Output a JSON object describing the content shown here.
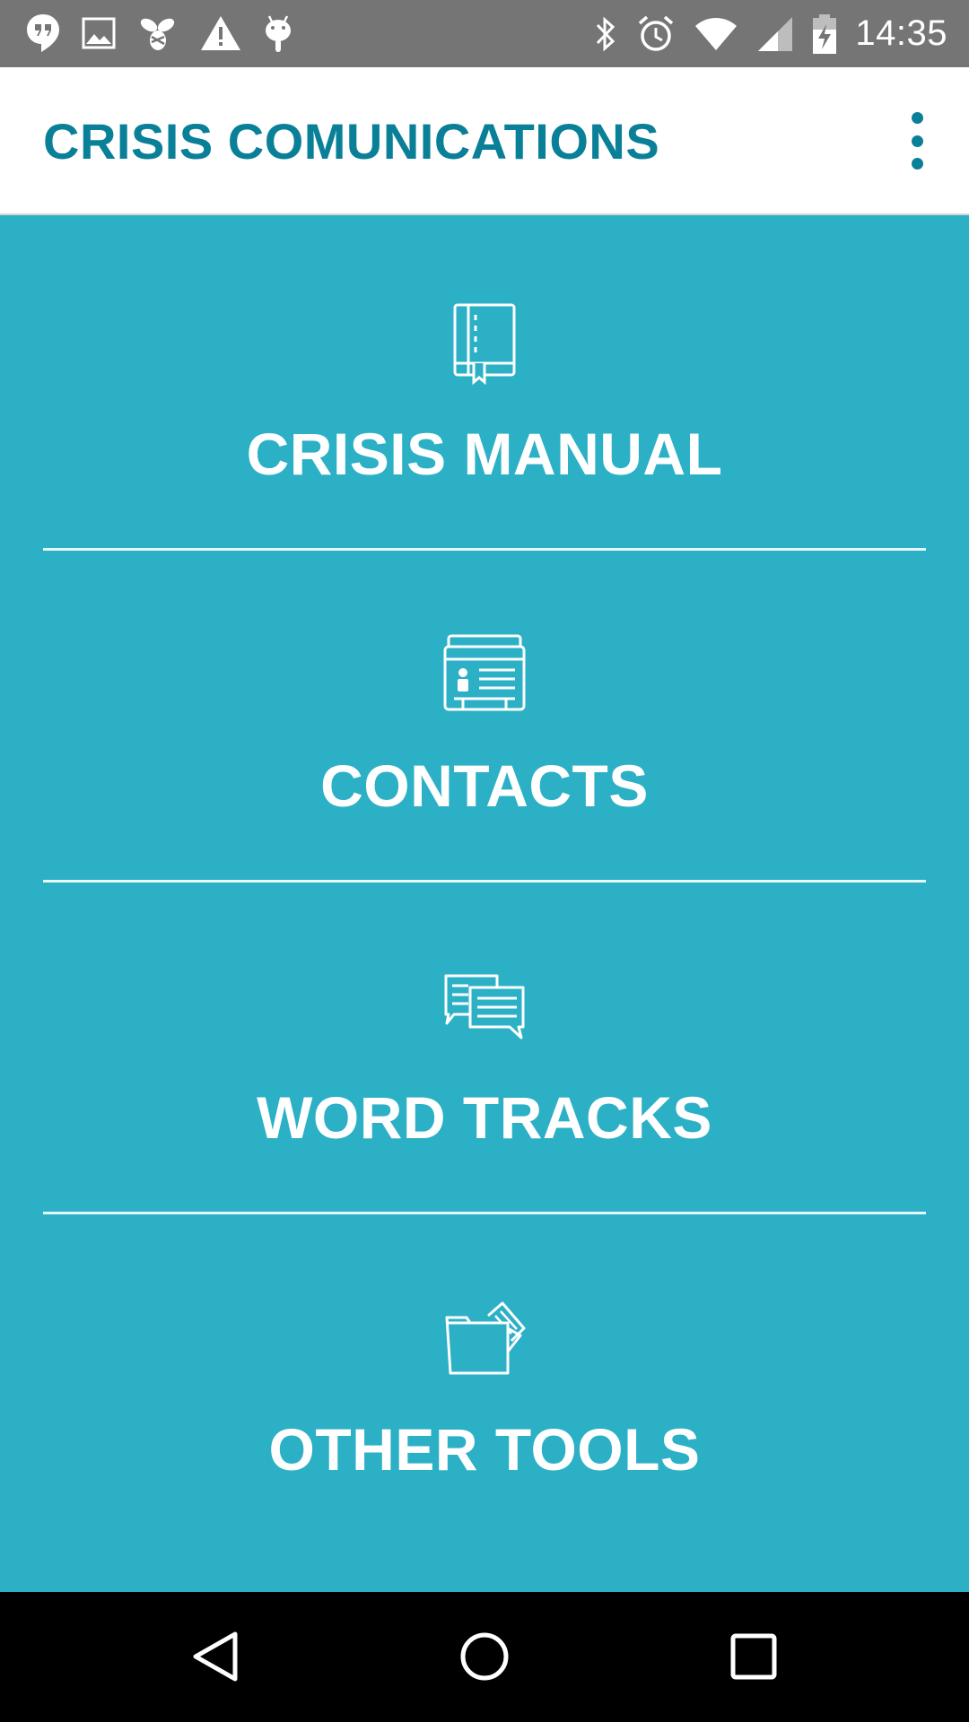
{
  "status_bar": {
    "time": "14:35",
    "left_icons": [
      "hangouts-icon",
      "image-icon",
      "swarm-icon",
      "warning-icon",
      "android-icon"
    ],
    "right_icons": [
      "bluetooth-icon",
      "alarm-icon",
      "wifi-icon",
      "cell-signal-icon",
      "battery-charging-icon"
    ]
  },
  "app_bar": {
    "title": "CRISIS COMUNICATIONS",
    "menu_icon": "more-vert-icon"
  },
  "menu": {
    "items": [
      {
        "label": "CRISIS MANUAL",
        "icon": "book-icon"
      },
      {
        "label": "CONTACTS",
        "icon": "contact-card-icon"
      },
      {
        "label": "WORD TRACKS",
        "icon": "chat-bubbles-icon"
      },
      {
        "label": "OTHER TOOLS",
        "icon": "folder-tools-icon"
      }
    ]
  },
  "nav_bar": {
    "buttons": [
      "back-icon",
      "home-icon",
      "recents-icon"
    ]
  },
  "colors": {
    "status_bar": "#757575",
    "app_bar_bg": "#ffffff",
    "accent": "#0a8098",
    "content_bg": "#2bb0c6",
    "label": "#ffffff",
    "nav_bar": "#000000"
  }
}
